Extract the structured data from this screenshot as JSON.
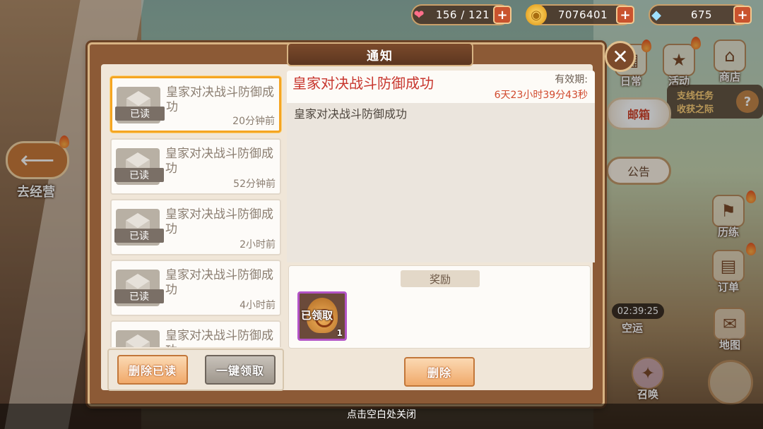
{
  "resources": {
    "stamina": "156 / 121",
    "gold": "7076401",
    "gems": "675",
    "plus": "+"
  },
  "panel": {
    "title": "通知"
  },
  "left_nav": {
    "go_business": "去经营"
  },
  "right_menu": {
    "daily": "日常",
    "event": "活动",
    "shop": "商店",
    "mailbox": "邮箱",
    "notice": "公告",
    "training": "历练",
    "orders": "订单",
    "shipping": "空运",
    "map": "地图",
    "summon": "召唤"
  },
  "side_quest": {
    "line1": "支线任务",
    "line2": "收获之际",
    "help": "?"
  },
  "timer": "02:39:25",
  "mails": [
    {
      "title": "皇家对决战斗防御成功",
      "tag": "已读",
      "time": "20分钟前"
    },
    {
      "title": "皇家对决战斗防御成功",
      "tag": "已读",
      "time": "52分钟前"
    },
    {
      "title": "皇家对决战斗防御成功",
      "tag": "已读",
      "time": "2小时前"
    },
    {
      "title": "皇家对决战斗防御成功",
      "tag": "已读",
      "time": "4小时前"
    },
    {
      "title": "皇家对决战斗防御成功",
      "tag": "",
      "time": ""
    }
  ],
  "list_buttons": {
    "delete_read": "删除已读",
    "claim_all": "一键领取"
  },
  "detail": {
    "title": "皇家对决战斗防御成功",
    "valid_label": "有效期:",
    "valid_time": "6天23小时39分43秒",
    "body": "皇家对决战斗防御成功",
    "reward_label": "奖励",
    "reward_claimed": "已领取",
    "reward_count": "1",
    "delete": "删除"
  },
  "hint": "点击空白处关闭",
  "colors": {
    "accent_red": "#c8362e",
    "panel_brown": "#8c5a36",
    "highlight_orange": "#f5a522"
  }
}
